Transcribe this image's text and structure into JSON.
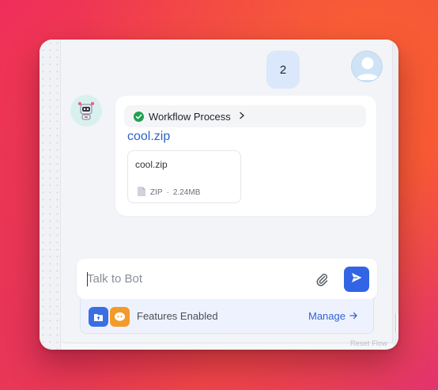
{
  "conversation": {
    "user_message": "2",
    "bot": {
      "workflow_label": "Workflow Process",
      "file_link": "cool.zip",
      "file_card": {
        "name": "cool.zip",
        "type": "ZIP",
        "separator": "·",
        "size": "2.24MB"
      }
    }
  },
  "composer": {
    "placeholder": "Talk to Bot",
    "value": ""
  },
  "features": {
    "label": "Features Enabled",
    "manage_label": "Manage"
  },
  "footer": {
    "reset_label": "Reset Flow"
  },
  "icons": {
    "user_avatar": "user-avatar-icon",
    "bot_avatar": "robot-icon",
    "workflow_status": "check-circle-icon",
    "workflow_expand": "chevron-right-icon",
    "file": "file-icon",
    "attach": "paperclip-icon",
    "send": "send-icon",
    "feature_upload": "folder-upload-icon",
    "feature_quote": "quote-icon",
    "manage_arrow": "arrow-right-icon"
  },
  "colors": {
    "accent": "#3264e6",
    "success": "#22a052",
    "user_bubble": "#dbe8fb",
    "feature_quote": "#f39a2a"
  }
}
